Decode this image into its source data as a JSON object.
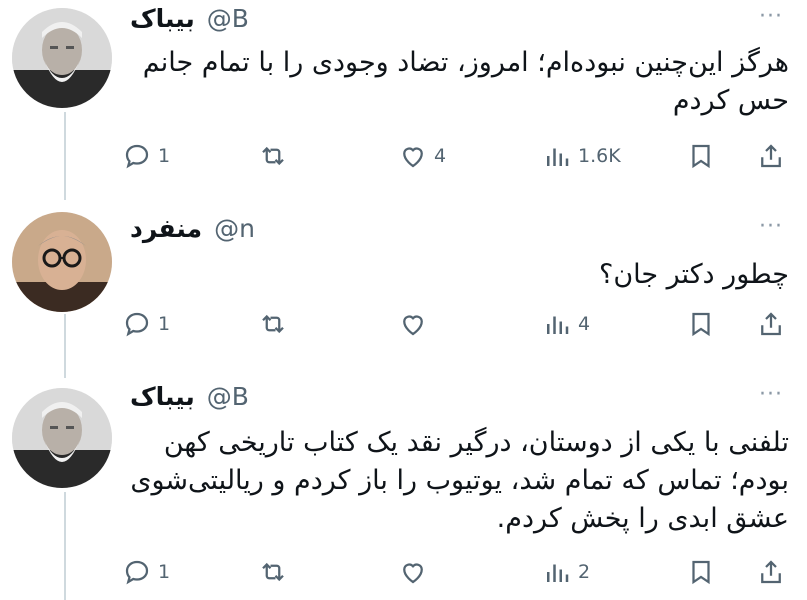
{
  "posts": [
    {
      "author_name": "بیباک",
      "handle": "@B",
      "text": "هرگز این‌چنین نبوده‌ام؛ امروز، تضاد وجودی را با تمام جانم حس کردم",
      "replies": "1",
      "reposts": "",
      "likes": "4",
      "views": "1.6K",
      "avatar": "bearded-old-man-portrait"
    },
    {
      "author_name": "منفرد",
      "handle": "@n",
      "text": "چطور دکتر جان؟",
      "replies": "1",
      "reposts": "",
      "likes": "",
      "views": "4",
      "avatar": "man-with-glasses-portrait"
    },
    {
      "author_name": "بیباک",
      "handle": "@B",
      "text": "تلفنی با یکی از دوستان، درگیر نقد یک کتاب تاریخی کهن بودم؛ تماس که تمام شد، یوتیوب را باز کردم و ریالیتی‌شوی عشق ابدی را پخش کردم.",
      "replies": "1",
      "reposts": "",
      "likes": "",
      "views": "2",
      "avatar": "bearded-old-man-portrait"
    }
  ],
  "more_glyph": "···",
  "colors": {
    "icon": "#536471",
    "thread_line": "#cfd9de",
    "text": "#0f1419"
  }
}
